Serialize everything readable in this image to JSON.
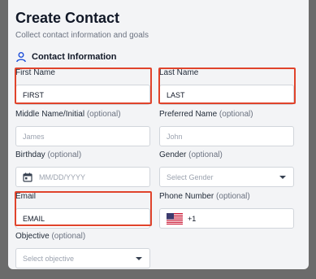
{
  "page": {
    "title": "Create Contact",
    "subtitle": "Collect contact information and goals",
    "section_title": "Contact Information"
  },
  "fields": {
    "first_name": {
      "label": "First Name",
      "value": "FIRST"
    },
    "last_name": {
      "label": "Last Name",
      "value": "LAST"
    },
    "middle_name": {
      "label": "Middle Name/Initial",
      "optional": "(optional)",
      "placeholder": "James"
    },
    "preferred_name": {
      "label": "Preferred Name",
      "optional": "(optional)",
      "placeholder": "John"
    },
    "birthday": {
      "label": "Birthday",
      "optional": "(optional)",
      "placeholder": "MM/DD/YYYY"
    },
    "gender": {
      "label": "Gender",
      "optional": "(optional)",
      "placeholder": "Select Gender"
    },
    "email": {
      "label": "Email",
      "value": "EMAIL"
    },
    "phone": {
      "label": "Phone Number",
      "optional": "(optional)",
      "country_code": "+1"
    },
    "objective": {
      "label": "Objective",
      "optional": "(optional)",
      "placeholder": "Select objective"
    }
  },
  "colors": {
    "highlight": "#e0442c",
    "accent": "#1d4ed8"
  },
  "icons": [
    "person-icon",
    "calendar-icon",
    "us-flag-icon",
    "chevron-down-icon"
  ]
}
